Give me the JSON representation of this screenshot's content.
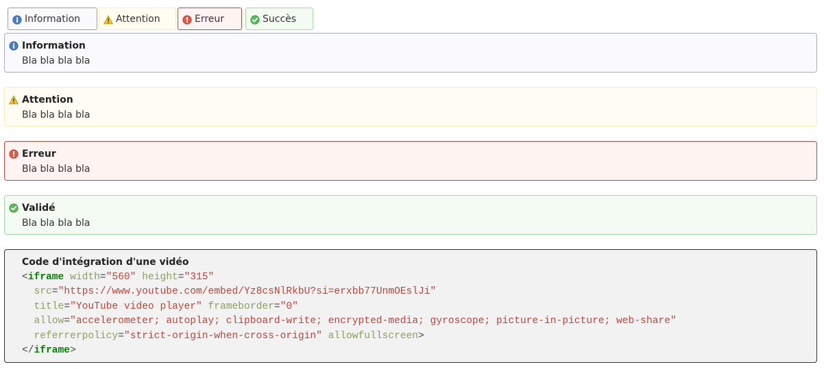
{
  "tabs": [
    {
      "label": "Information",
      "icon": "info-icon"
    },
    {
      "label": "Attention",
      "icon": "warning-icon"
    },
    {
      "label": "Erreur",
      "icon": "error-icon"
    },
    {
      "label": "Succès",
      "icon": "success-icon"
    }
  ],
  "messages": [
    {
      "type": "info",
      "title": "Information",
      "body": "Bla bla bla bla",
      "icon": "info-icon"
    },
    {
      "type": "warning",
      "title": "Attention",
      "body": "Bla bla bla bla",
      "icon": "warning-icon"
    },
    {
      "type": "error",
      "title": "Erreur",
      "body": "Bla bla bla bla",
      "icon": "error-icon"
    },
    {
      "type": "success",
      "title": "Validé",
      "body": "Bla bla bla bla",
      "icon": "success-icon"
    }
  ],
  "code_block": {
    "title": "Code d'intégration d'une vidéo",
    "tag": "iframe",
    "attrs": {
      "width": {
        "name": "width",
        "value": "\"560\""
      },
      "height": {
        "name": "height",
        "value": "\"315\""
      },
      "src": {
        "name": "src",
        "value": "\"https://www.youtube.com/embed/Yz8csNlRkbU?si=erxbb77UnmOEslJi\""
      },
      "title": {
        "name": "title",
        "value": "\"YouTube video player\""
      },
      "frameborder": {
        "name": "frameborder",
        "value": "\"0\""
      },
      "allow": {
        "name": "allow",
        "value": "\"accelerometer; autoplay; clipboard-write; encrypted-media; gyroscope; picture-in-picture; web-share\""
      },
      "referrerpolicy": {
        "name": "referrerpolicy",
        "value": "\"strict-origin-when-cross-origin\""
      },
      "allowfullscreen": {
        "name": "allowfullscreen"
      }
    }
  },
  "colors": {
    "info_border": "#a9adb9",
    "warning_border": "#f7ecbe",
    "error_border": "#c2463a",
    "success_border": "#a3d6a7",
    "code_tag": "#068006",
    "code_attr": "#8aa05c",
    "code_value": "#b8453b"
  }
}
